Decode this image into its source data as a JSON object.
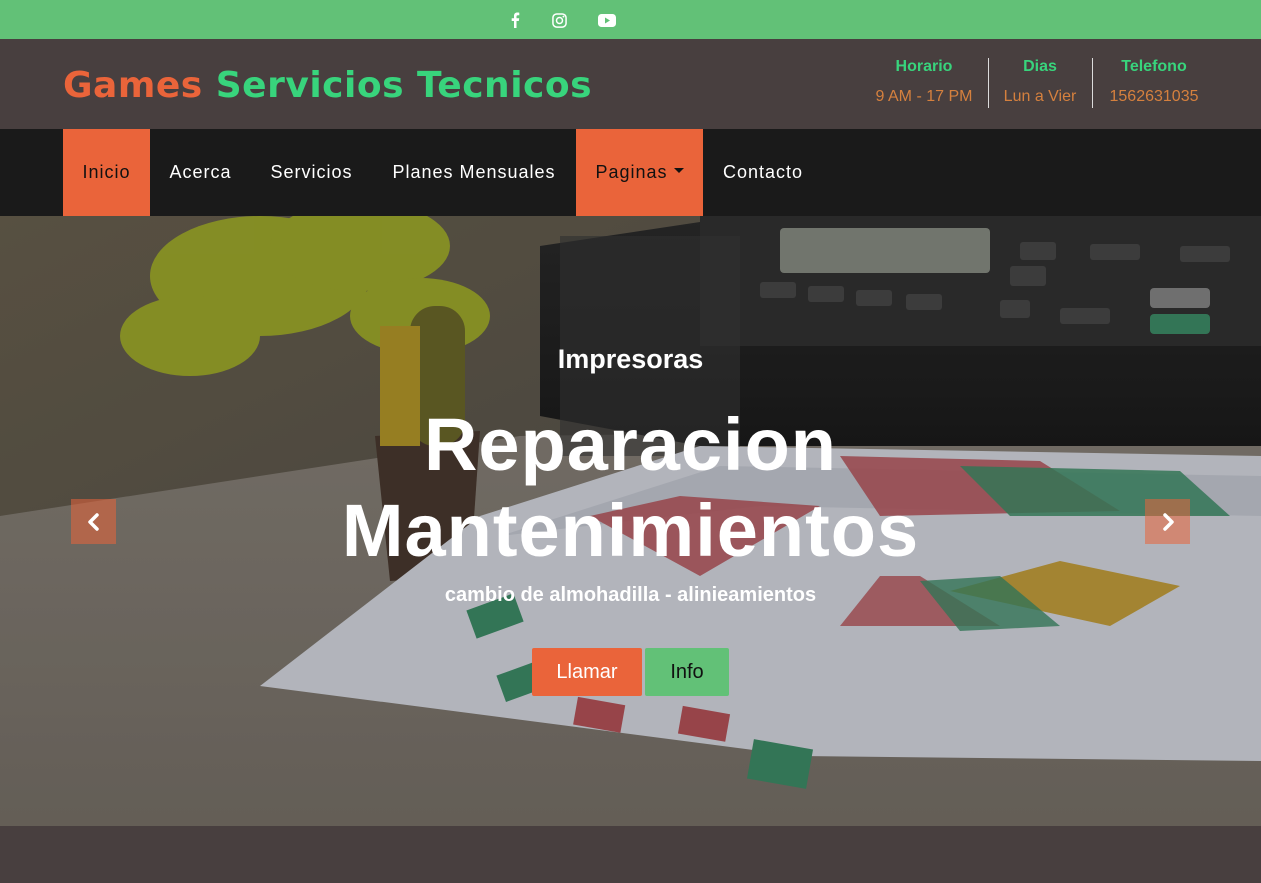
{
  "topbar": {
    "social": [
      {
        "icon": "facebook-icon"
      },
      {
        "icon": "instagram-icon"
      },
      {
        "icon": "youtube-icon"
      }
    ]
  },
  "header": {
    "brand_part1": "Games",
    "brand_part2": "Servicios Tecnicos",
    "info": [
      {
        "label": "Horario",
        "value": "9 AM - 17 PM"
      },
      {
        "label": "Dias",
        "value": "Lun a Vier"
      },
      {
        "label": "Telefono",
        "value": "1562631035"
      }
    ]
  },
  "nav": {
    "items": [
      {
        "label": "Inicio",
        "active": true
      },
      {
        "label": "Acerca",
        "active": false
      },
      {
        "label": "Servicios",
        "active": false
      },
      {
        "label": "Planes Mensuales",
        "active": false
      },
      {
        "label": "Paginas",
        "active": true,
        "dropdown": true
      },
      {
        "label": "Contacto",
        "active": false
      }
    ]
  },
  "hero": {
    "subtitle": "Impresoras",
    "title_line1": "Reparacion",
    "title_line2": "Mantenimientos",
    "description": "cambio de almohadilla - alinieamientos",
    "button_primary": "Llamar",
    "button_secondary": "Info"
  },
  "colors": {
    "accent_orange": "#ea643a",
    "accent_green": "#62c177",
    "brand_green": "#38d47c",
    "header_bg": "#483f3f",
    "nav_bg": "#1a1a1a"
  }
}
